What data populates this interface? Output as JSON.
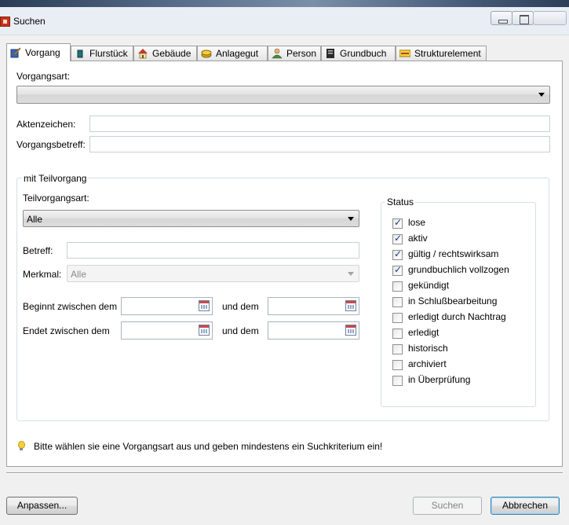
{
  "window": {
    "title": "Suchen"
  },
  "tabs": [
    {
      "label": "Vorgang",
      "icon": "pencil-book-icon"
    },
    {
      "label": "Flurstück",
      "icon": "parcel-marker-icon"
    },
    {
      "label": "Gebäude",
      "icon": "house-icon"
    },
    {
      "label": "Anlagegut",
      "icon": "coins-icon"
    },
    {
      "label": "Person",
      "icon": "person-icon"
    },
    {
      "label": "Grundbuch",
      "icon": "ledger-book-icon"
    },
    {
      "label": "Strukturelement",
      "icon": "street-sign-icon"
    }
  ],
  "form": {
    "vorgangsart_label": "Vorgangsart:",
    "vorgangsart_value": "",
    "aktenzeichen_label": "Aktenzeichen:",
    "aktenzeichen_value": "",
    "vorgangsbetreff_label": "Vorgangsbetreff:",
    "vorgangsbetreff_value": ""
  },
  "teilvorgang": {
    "group_title": "mit Teilvorgang",
    "art_label": "Teilvorgangsart:",
    "art_value": "Alle",
    "betreff_label": "Betreff:",
    "betreff_value": "",
    "merkmal_label": "Merkmal:",
    "merkmal_value": "Alle",
    "beginnt_label": "Beginnt zwischen dem",
    "endet_label": "Endet zwischen dem",
    "und_dem_label": "und dem",
    "beginnt_from": "",
    "beginnt_to": "",
    "endet_from": "",
    "endet_to": ""
  },
  "status": {
    "title": "Status",
    "items": [
      {
        "label": "lose",
        "checked": true
      },
      {
        "label": "aktiv",
        "checked": true
      },
      {
        "label": "gültig / rechtswirksam",
        "checked": true
      },
      {
        "label": "grundbuchlich vollzogen",
        "checked": true
      },
      {
        "label": "gekündigt",
        "checked": false
      },
      {
        "label": "in Schlußbearbeitung",
        "checked": false
      },
      {
        "label": "erledigt durch Nachtrag",
        "checked": false
      },
      {
        "label": "erledigt",
        "checked": false
      },
      {
        "label": "historisch",
        "checked": false
      },
      {
        "label": "archiviert",
        "checked": false
      },
      {
        "label": "in Überprüfung",
        "checked": false
      }
    ]
  },
  "hint": "Bitte wählen sie eine Vorgangsart aus und geben mindestens ein Suchkriterium ein!",
  "buttons": {
    "anpassen": "Anpassen...",
    "suchen": "Suchen",
    "abbrechen": "Abbrechen"
  }
}
